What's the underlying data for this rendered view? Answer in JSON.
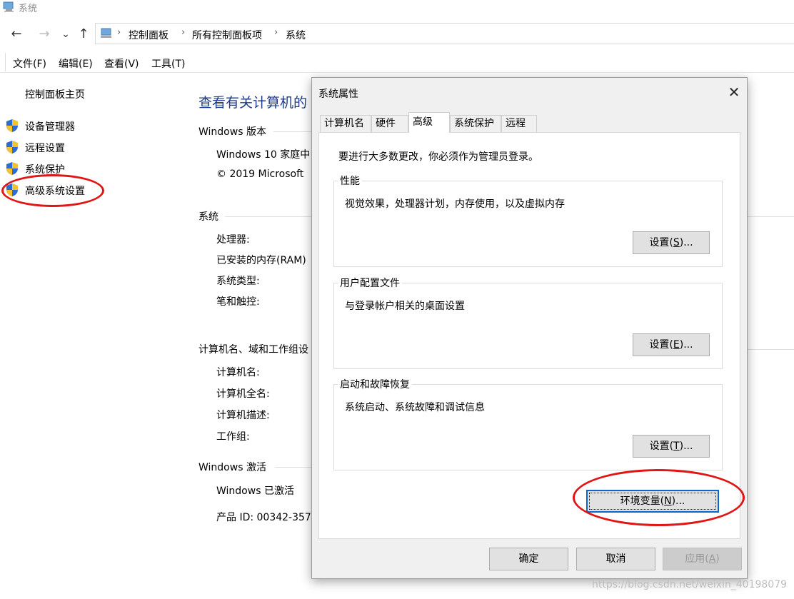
{
  "window": {
    "title": "系统"
  },
  "nav": {
    "back_glyph": "←",
    "forward_glyph": "→",
    "recent_glyph": "⌄",
    "up_glyph": "↑",
    "breadcrumbs": [
      "控制面板",
      "所有控制面板项",
      "系统"
    ],
    "sep": "›"
  },
  "menu": [
    "文件(F)",
    "编辑(E)",
    "查看(V)",
    "工具(T)"
  ],
  "sidebar": {
    "home": "控制面板主页",
    "items": [
      "设备管理器",
      "远程设置",
      "系统保护",
      "高级系统设置"
    ]
  },
  "main": {
    "heading": "查看有关计算机的",
    "sections": {
      "windows_edition": {
        "title": "Windows 版本",
        "rows": [
          "Windows 10 家庭中",
          "© 2019 Microsoft"
        ]
      },
      "system": {
        "title": "系统",
        "rows": [
          "处理器:",
          "已安装的内存(RAM)",
          "系统类型:",
          "笔和触控:"
        ]
      },
      "computer_name": {
        "title": "计算机名、域和工作组设",
        "rows": [
          "计算机名:",
          "计算机全名:",
          "计算机描述:",
          "工作组:"
        ]
      },
      "activation": {
        "title": "Windows 激活",
        "rows": [
          "Windows 已激活",
          "产品 ID: 00342-357"
        ]
      }
    }
  },
  "dialog": {
    "title": "系统属性",
    "close_glyph": "✕",
    "tabs": [
      "计算机名",
      "硬件",
      "高级",
      "系统保护",
      "远程"
    ],
    "active_tab": "高级",
    "note": "要进行大多数更改，你必须作为管理员登录。",
    "groups": [
      {
        "title": "性能",
        "desc": "视觉效果，处理器计划，内存使用，以及虚拟内存",
        "button_pre": "设置(",
        "button_key": "S",
        "button_post": ")..."
      },
      {
        "title": "用户配置文件",
        "desc": "与登录帐户相关的桌面设置",
        "button_pre": "设置(",
        "button_key": "E",
        "button_post": ")..."
      },
      {
        "title": "启动和故障恢复",
        "desc": "系统启动、系统故障和调试信息",
        "button_pre": "设置(",
        "button_key": "T",
        "button_post": ")..."
      }
    ],
    "env_button": {
      "pre": "环境变量(",
      "key": "N",
      "post": ")..."
    },
    "ok_button": "确定",
    "cancel_button": "取消",
    "apply_button": {
      "pre": "应用(",
      "key": "A",
      "post": ")"
    }
  },
  "watermark": "https://blog.csdn.net/weixin_40198079",
  "colors": {
    "accent": "#1e3a8a",
    "highlight_ring": "#e01515",
    "focus_border": "#0a66c8"
  }
}
